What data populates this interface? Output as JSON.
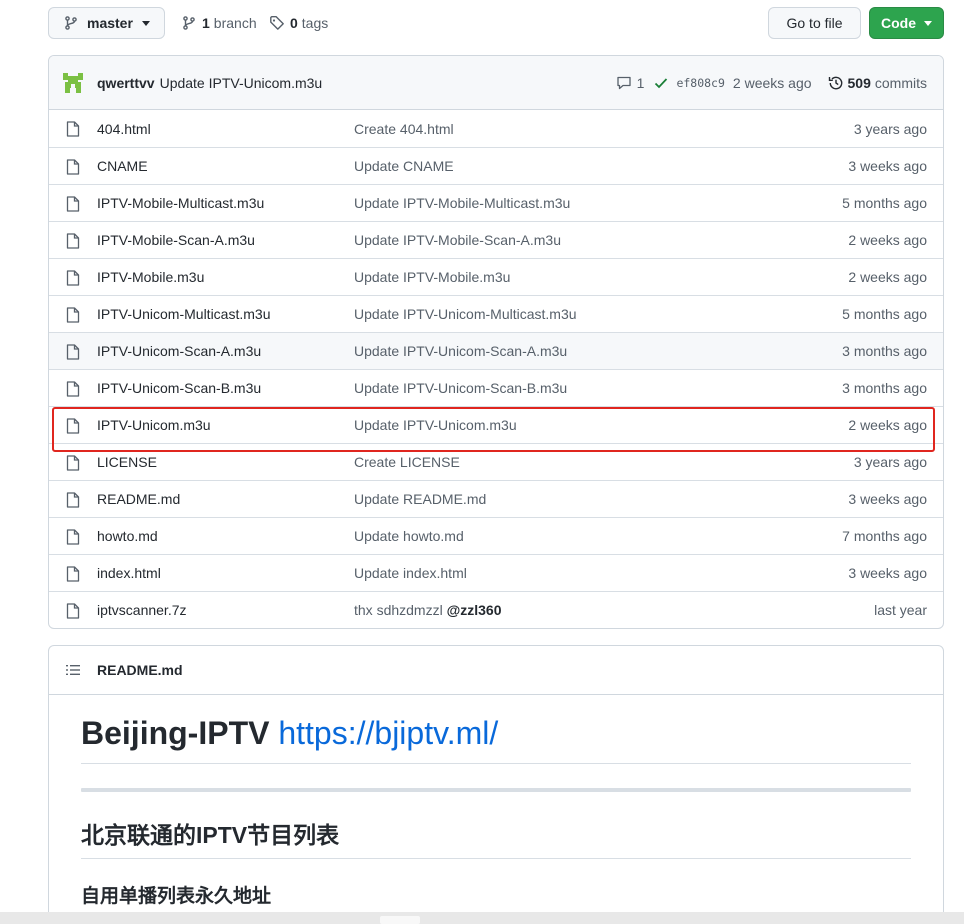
{
  "toolbar": {
    "branch": "master",
    "branch_count": "1",
    "branch_label": "branch",
    "tag_count": "0",
    "tag_label": "tags",
    "goto_file": "Go to file",
    "code": "Code"
  },
  "latest_commit": {
    "author": "qwerttvv",
    "message": "Update IPTV-Unicom.m3u",
    "comments": "1",
    "sha": "ef808c9",
    "age": "2 weeks ago",
    "commit_count": "509",
    "commits_label": "commits"
  },
  "files": [
    {
      "name": "404.html",
      "message": "Create 404.html",
      "age": "3 years ago"
    },
    {
      "name": "CNAME",
      "message": "Update CNAME",
      "age": "3 weeks ago"
    },
    {
      "name": "IPTV-Mobile-Multicast.m3u",
      "message": "Update IPTV-Mobile-Multicast.m3u",
      "age": "5 months ago"
    },
    {
      "name": "IPTV-Mobile-Scan-A.m3u",
      "message": "Update IPTV-Mobile-Scan-A.m3u",
      "age": "2 weeks ago"
    },
    {
      "name": "IPTV-Mobile.m3u",
      "message": "Update IPTV-Mobile.m3u",
      "age": "2 weeks ago"
    },
    {
      "name": "IPTV-Unicom-Multicast.m3u",
      "message": "Update IPTV-Unicom-Multicast.m3u",
      "age": "5 months ago"
    },
    {
      "name": "IPTV-Unicom-Scan-A.m3u",
      "message": "Update IPTV-Unicom-Scan-A.m3u",
      "age": "3 months ago"
    },
    {
      "name": "IPTV-Unicom-Scan-B.m3u",
      "message": "Update IPTV-Unicom-Scan-B.m3u",
      "age": "3 months ago"
    },
    {
      "name": "IPTV-Unicom.m3u",
      "message": "Update IPTV-Unicom.m3u",
      "age": "2 weeks ago"
    },
    {
      "name": "LICENSE",
      "message": "Create LICENSE",
      "age": "3 years ago"
    },
    {
      "name": "README.md",
      "message": "Update README.md",
      "age": "3 weeks ago"
    },
    {
      "name": "howto.md",
      "message": "Update howto.md",
      "age": "7 months ago"
    },
    {
      "name": "index.html",
      "message": "Update index.html",
      "age": "3 weeks ago"
    },
    {
      "name": "iptvscanner.7z",
      "message": "thx sdhzdmzzl",
      "mention": "@zzl360",
      "age": "last year"
    }
  ],
  "readme": {
    "filename": "README.md",
    "h1_text": "Beijing-IPTV",
    "h1_link": "https://bjiptv.ml/",
    "h2": "北京联通的IPTV节目列表",
    "h3": "自用单播列表永久地址"
  },
  "colors": {
    "accent_green": "#2da44e",
    "link_blue": "#0969da",
    "highlight_red": "#e0261f"
  }
}
